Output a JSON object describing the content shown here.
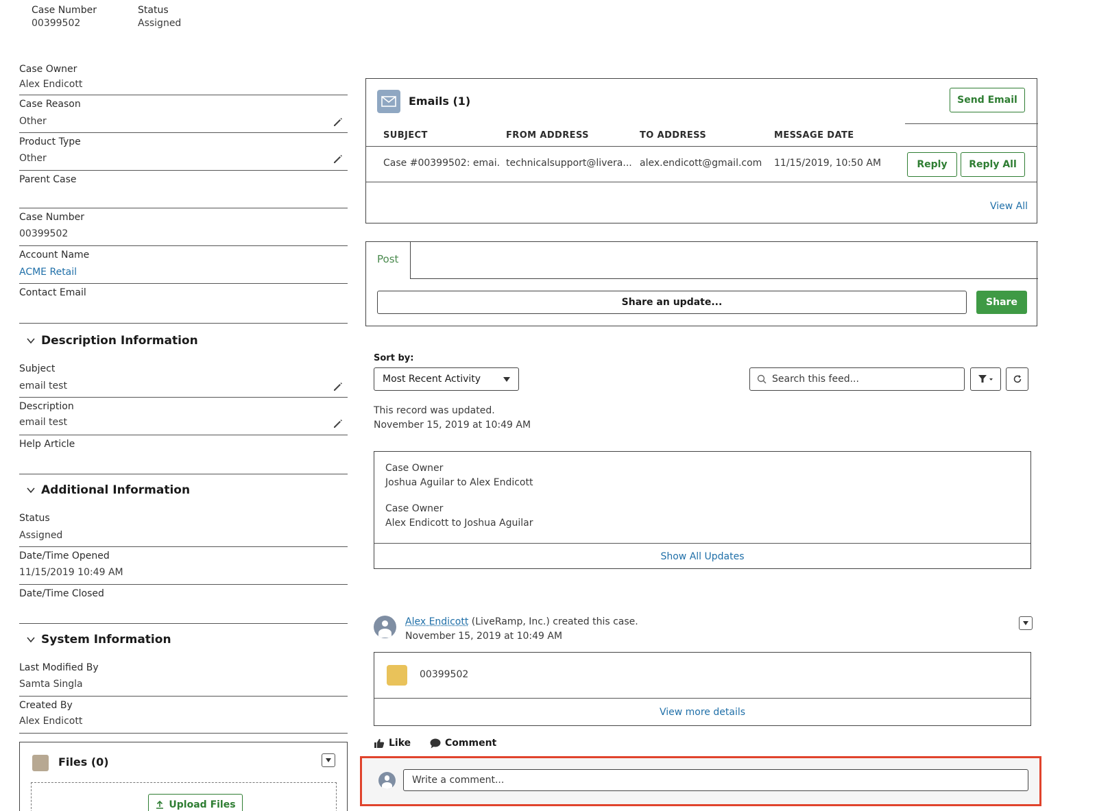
{
  "header": {
    "case_number_label": "Case Number",
    "case_number_value": "00399502",
    "status_label": "Status",
    "status_value": "Assigned"
  },
  "details": {
    "case_owner": {
      "label": "Case Owner",
      "value": "Alex Endicott"
    },
    "case_reason": {
      "label": "Case Reason",
      "value": "Other"
    },
    "product_type": {
      "label": "Product Type",
      "value": "Other"
    },
    "parent_case": {
      "label": "Parent Case",
      "value": ""
    },
    "case_number": {
      "label": "Case Number",
      "value": "00399502"
    },
    "account_name": {
      "label": "Account Name",
      "value": "ACME Retail"
    },
    "contact_email": {
      "label": "Contact Email",
      "value": ""
    }
  },
  "description_section": {
    "title": "Description Information",
    "subject": {
      "label": "Subject",
      "value": "email test"
    },
    "description": {
      "label": "Description",
      "value": "email test"
    },
    "help_article": {
      "label": "Help Article",
      "value": ""
    }
  },
  "additional_section": {
    "title": "Additional Information",
    "status": {
      "label": "Status",
      "value": "Assigned"
    },
    "date_opened": {
      "label": "Date/Time Opened",
      "value": "11/15/2019 10:49 AM"
    },
    "date_closed": {
      "label": "Date/Time Closed",
      "value": ""
    }
  },
  "system_section": {
    "title": "System Information",
    "last_modified_by": {
      "label": "Last Modified By",
      "value": "Samta Singla"
    },
    "created_by": {
      "label": "Created By",
      "value": "Alex Endicott"
    }
  },
  "files": {
    "title": "Files (0)",
    "upload_label": "Upload Files"
  },
  "emails": {
    "title": "Emails (1)",
    "send_email_label": "Send Email",
    "columns": [
      "SUBJECT",
      "FROM ADDRESS",
      "TO ADDRESS",
      "MESSAGE DATE"
    ],
    "rows": [
      {
        "subject": "Case #00399502: emai...",
        "from": "technicalsupport@livera...",
        "to": "alex.endicott@gmail.com",
        "date": "11/15/2019, 10:50 AM"
      }
    ],
    "reply_label": "Reply",
    "reply_all_label": "Reply All",
    "view_all_label": "View All"
  },
  "publisher": {
    "post_tab": "Post",
    "share_placeholder": "Share an update...",
    "share_button": "Share"
  },
  "feed": {
    "sort_label": "Sort by:",
    "sort_value": "Most Recent Activity",
    "search_placeholder": "Search this feed...",
    "record_updated": "This record was updated.",
    "record_updated_date": "November 15, 2019 at 10:49 AM",
    "updates": [
      {
        "field": "Case Owner",
        "change": "Joshua Aguilar to Alex Endicott"
      },
      {
        "field": "Case Owner",
        "change": "Alex Endicott to Joshua Aguilar"
      }
    ],
    "show_all_updates": "Show All Updates",
    "post_author": "Alex Endicott",
    "post_text": " (LiveRamp, Inc.) created this case.",
    "post_date": "November 15, 2019 at 10:49 AM",
    "case_ref": "00399502",
    "view_more_details": "View more details",
    "like_label": "Like",
    "comment_label": "Comment",
    "comment_placeholder": "Write a comment..."
  },
  "colors": {
    "accent_green": "#2e7d32",
    "share_green": "#3f9a45",
    "link_blue": "#1f6fa8",
    "highlight_red": "#e0432c"
  }
}
